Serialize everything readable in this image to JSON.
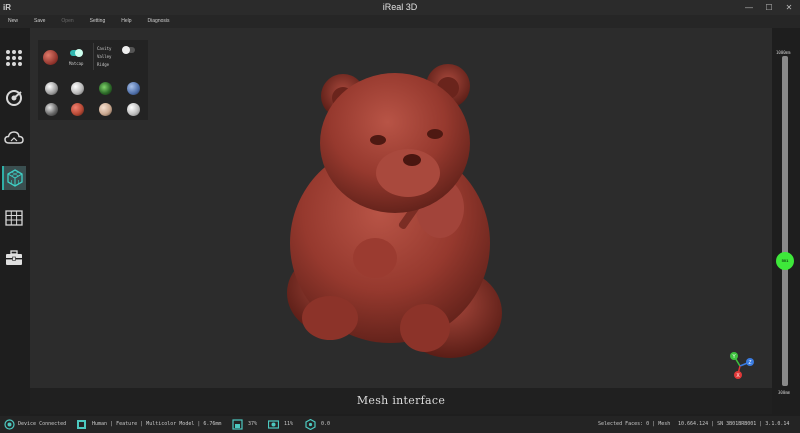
{
  "app": {
    "title": "iReal 3D",
    "logo": "iR"
  },
  "window_controls": {
    "minimize": "—",
    "maximize": "☐",
    "close": "✕"
  },
  "menu": [
    {
      "label": "New",
      "enabled": true
    },
    {
      "label": "Save",
      "enabled": true
    },
    {
      "label": "Open",
      "enabled": false
    },
    {
      "label": "Setting",
      "enabled": true
    },
    {
      "label": "Help",
      "enabled": true
    },
    {
      "label": "Diagnosis",
      "enabled": true
    }
  ],
  "toolbar": {
    "tools": [
      "grid-dots-icon",
      "scan-target-icon",
      "cloud-icon",
      "mesh-cube-icon",
      "table-grid-icon",
      "toolbox-icon"
    ],
    "active_tool": "mesh-cube-icon",
    "accent": "#2fb0a8"
  },
  "material_panel": {
    "matcap_label": "Matcap",
    "matcap_on": true,
    "options": [
      "Cavity",
      "Valley",
      "Ridge"
    ],
    "cavity_on": false,
    "colors": {
      "selected": "#8a2f28",
      "swatches": [
        "#d8d8d8",
        "#e6e6e6",
        "#2e6b2a",
        "#4d6ea8",
        "#6a6a6a",
        "#b84a36",
        "#c9a890",
        "#c0c0c0"
      ]
    }
  },
  "viewport": {
    "label": "Mesh interface",
    "background": "#2c2c2c",
    "model_color": "#9a3f33",
    "axis": {
      "x": "X",
      "y": "Y",
      "z": "Z"
    }
  },
  "slider": {
    "top_label": "1000mm",
    "bottom_label": "300mm",
    "knob_label": "501",
    "knob_color": "#3ee83a"
  },
  "status": {
    "device": "Device Connected",
    "mode": "Human | Feature | Multicolor Model | 6.76mm",
    "percent": "37%",
    "frames": "11%",
    "value": "0.0",
    "faces": "Selected Faces: 0 | Mesh",
    "tail": "10.664.124 | SN 3B01BRB001 | 3.1.0.14"
  }
}
